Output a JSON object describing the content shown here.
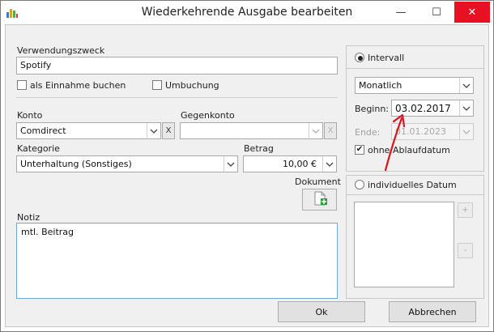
{
  "window": {
    "title": "Wiederkehrende Ausgabe bearbeiten",
    "minimize_glyph": "—",
    "maximize_glyph": "☐",
    "close_glyph": "✕"
  },
  "form": {
    "verwendungszweck_label": "Verwendungszweck",
    "verwendungszweck_value": "Spotify",
    "einnahme_label": "als Einnahme buchen",
    "umbuchung_label": "Umbuchung",
    "konto_label": "Konto",
    "konto_value": "Comdirect",
    "gegenkonto_label": "Gegenkonto",
    "gegenkonto_value": "",
    "kategorie_label": "Kategorie",
    "kategorie_value": "Unterhaltung (Sonstiges)",
    "betrag_label": "Betrag",
    "betrag_value": "10,00 €",
    "dokument_label": "Dokument",
    "notiz_label": "Notiz",
    "notiz_value": "mtl. Beitrag",
    "clear_glyph": "X"
  },
  "interval": {
    "intervall_label": "Intervall",
    "intervall_selected": true,
    "frequency_value": "Monatlich",
    "beginn_label": "Beginn:",
    "beginn_value": "03.02.2017",
    "ende_label": "Ende:",
    "ende_value": "01.01.2023",
    "no_expiry_label": "ohne Ablaufdatum",
    "no_expiry_checked": true,
    "individual_label": "individuelles Datum",
    "add_glyph": "+",
    "remove_glyph": "-"
  },
  "buttons": {
    "ok_label": "Ok",
    "cancel_label": "Abbrechen"
  },
  "colors": {
    "close_red": "#e81123",
    "annotation_arrow": "#e0121c"
  }
}
